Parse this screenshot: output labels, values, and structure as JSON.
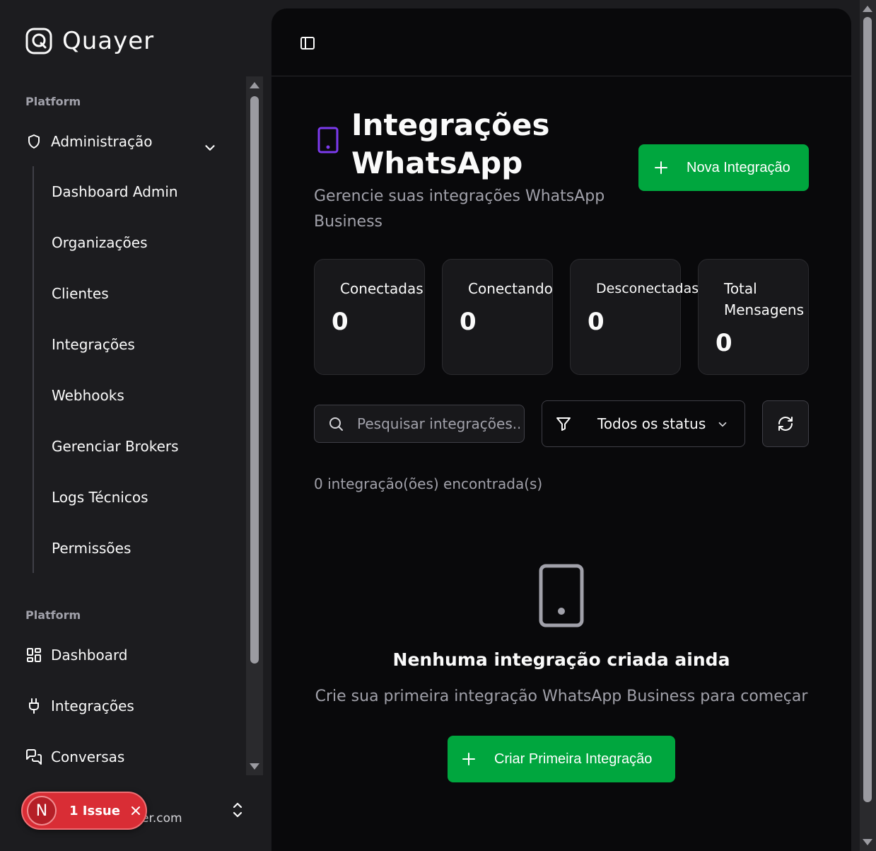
{
  "brand": {
    "name": "Quayer"
  },
  "sidebar": {
    "group1_label": "Platform",
    "admin": {
      "label": "Administração"
    },
    "sub_items": [
      {
        "label": "Dashboard Admin"
      },
      {
        "label": "Organizações"
      },
      {
        "label": "Clientes"
      },
      {
        "label": "Integrações"
      },
      {
        "label": "Webhooks"
      },
      {
        "label": "Gerenciar Brokers"
      },
      {
        "label": "Logs Técnicos"
      },
      {
        "label": "Permissões"
      }
    ],
    "group2_label": "Platform",
    "items": [
      {
        "label": "Dashboard",
        "icon": "dashboard-icon"
      },
      {
        "label": "Integrações",
        "icon": "plug-icon"
      },
      {
        "label": "Conversas",
        "icon": "messages-icon"
      }
    ],
    "user_email_partial": "er.com"
  },
  "issue_badge": {
    "letter": "N",
    "text": "1 Issue"
  },
  "page": {
    "title": "Integrações WhatsApp",
    "subtitle": "Gerencie suas integrações WhatsApp Business",
    "new_button": "Nova Integração"
  },
  "stats": [
    {
      "label": "Conectadas",
      "value": "0"
    },
    {
      "label": "Conectando",
      "value": "0"
    },
    {
      "label": "Desconectadas",
      "value": "0"
    },
    {
      "label": "Total\nMensagens",
      "value": "0"
    }
  ],
  "filters": {
    "search_placeholder": "Pesquisar integrações...",
    "status_selected": "Todos os status"
  },
  "results_count": "0 integração(ões) encontrada(s)",
  "empty_state": {
    "title": "Nenhuma integração criada ainda",
    "subtitle": "Crie sua primeira integração WhatsApp Business para começar",
    "button": "Criar Primeira Integração"
  },
  "colors": {
    "accent_green": "#00a63e",
    "title_icon_purple": "#7c3aed",
    "issue_red": "#d92d35"
  }
}
